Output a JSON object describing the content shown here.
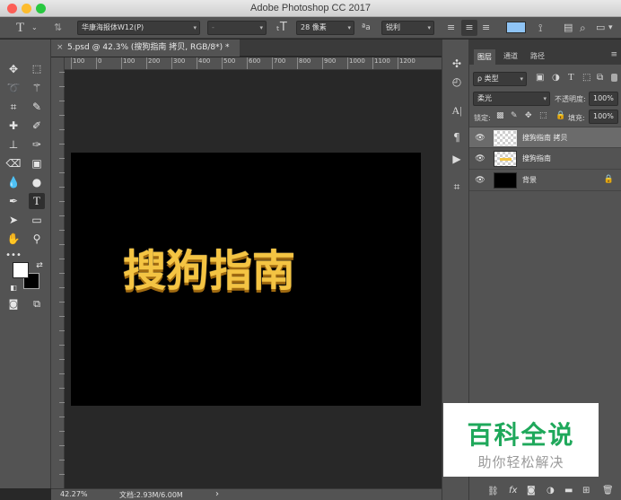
{
  "app": {
    "title": "Adobe Photoshop CC 2017"
  },
  "window_controls": {
    "close_color": "#fc5f57",
    "minimize_color": "#fdbc2e",
    "zoom_color": "#28c840"
  },
  "options_bar": {
    "font_family": "华康海报体W12(P)",
    "font_style": "-",
    "font_size": "28 像素",
    "aa_label": "ªa",
    "anti_alias": "锐利",
    "text_color": "#8fc4f5"
  },
  "document": {
    "tab_label": "5.psd @ 42.3% (搜狗指南 拷贝, RGB/8*) *",
    "close_glyph": "×",
    "canvas_text": "搜狗指南",
    "text_color": "#f4c443"
  },
  "ruler": {
    "ticks": [
      "100",
      "0",
      "100",
      "200",
      "300",
      "400",
      "500",
      "600",
      "700",
      "800",
      "900",
      "1000",
      "1100",
      "1200"
    ]
  },
  "status_bar": {
    "zoom": "42.27%",
    "doc_size": "文档:2.93M/6.00M",
    "arrow": "›"
  },
  "layers_panel": {
    "tabs": [
      "图层",
      "通道",
      "路径"
    ],
    "filter_label": "ρ 类型",
    "blend_mode": "柔光",
    "opacity_label": "不透明度:",
    "opacity_value": "100%",
    "lock_label": "锁定:",
    "fill_label": "填充:",
    "fill_value": "100%",
    "layers": [
      {
        "name": "搜狗指南 拷贝",
        "selected": true
      },
      {
        "name": "搜狗指南",
        "selected": false
      },
      {
        "name": "背景",
        "selected": false
      }
    ]
  },
  "watermark": {
    "title": "百科全说",
    "subtitle": "助你轻松解决",
    "color": "#1fa85b"
  }
}
